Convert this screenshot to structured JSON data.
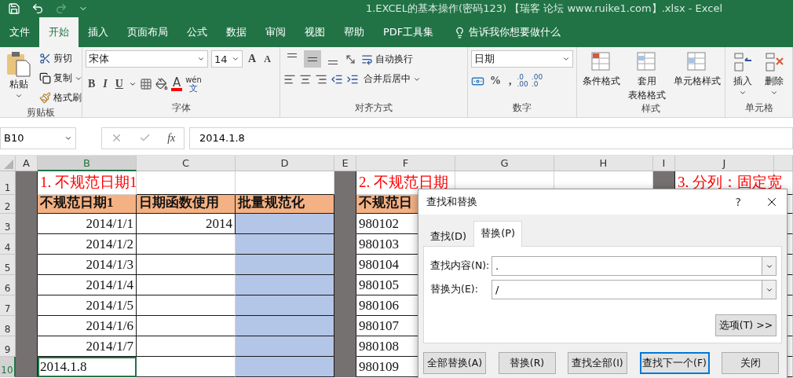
{
  "window": {
    "title": "1.EXCEL的基本操作(密码123) 【瑞客 论坛 www.ruike1.com】.xlsx  -  Excel"
  },
  "ribbon_tabs": [
    {
      "label": "文件",
      "selected": false
    },
    {
      "label": "开始",
      "selected": true
    },
    {
      "label": "插入",
      "selected": false
    },
    {
      "label": "页面布局",
      "selected": false
    },
    {
      "label": "公式",
      "selected": false
    },
    {
      "label": "数据",
      "selected": false
    },
    {
      "label": "审阅",
      "selected": false
    },
    {
      "label": "视图",
      "selected": false
    },
    {
      "label": "帮助",
      "selected": false
    },
    {
      "label": "PDF工具集",
      "selected": false
    }
  ],
  "tell_me": "告诉我你想要做什么",
  "clipboard": {
    "paste": "粘贴",
    "cut": "剪切",
    "copy": "复制",
    "format_painter": "格式刷",
    "label": "剪贴板"
  },
  "font": {
    "name": "宋体",
    "size": "14",
    "grow": "A",
    "shrink": "A",
    "bold": "B",
    "italic": "I",
    "underline": "U",
    "font_color": "A",
    "phonetic_top": "wén",
    "phonetic_bottom": "文",
    "label": "字体"
  },
  "alignment": {
    "vertical": [
      {
        "selected": false
      },
      {
        "selected": true
      },
      {
        "selected": false
      }
    ],
    "wrap_text": "自动换行",
    "merge_center": "合并后居中",
    "label": "对齐方式"
  },
  "number": {
    "format": "日期",
    "percent": "%",
    "comma": ",",
    "increase_decimal": [
      ".0",
      ".00"
    ],
    "decrease_decimal": [
      ".00",
      ".0"
    ],
    "label": "数字"
  },
  "styles": {
    "items": [
      [
        "条件格式"
      ],
      [
        "套用",
        "表格格式"
      ],
      [
        "单元格样式"
      ]
    ],
    "label": "样式"
  },
  "cells": {
    "items": [
      "插入",
      "删除"
    ],
    "label": "单元格"
  },
  "formula_bar": {
    "name_box": "B10",
    "function_label": "fx",
    "value": "2014.1.8"
  },
  "sheet": {
    "columns": [
      {
        "label": "A",
        "kind": "narrow",
        "selected": false
      },
      {
        "label": "B",
        "kind": "wide",
        "selected": true
      },
      {
        "label": "C",
        "kind": "wide",
        "selected": false
      },
      {
        "label": "D",
        "kind": "wide",
        "selected": false
      },
      {
        "label": "E",
        "kind": "narrow",
        "selected": false
      },
      {
        "label": "F",
        "kind": "wide",
        "selected": false
      },
      {
        "label": "G",
        "kind": "wide",
        "selected": false
      },
      {
        "label": "H",
        "kind": "wide",
        "selected": false
      },
      {
        "label": "I",
        "kind": "narrow",
        "selected": false
      },
      {
        "label": "J",
        "kind": "wide",
        "selected": false
      }
    ],
    "rows": [
      {
        "label": "1",
        "selected": false,
        "cells": [
          {
            "kind": "spacer"
          },
          {
            "kind": "title",
            "text": "1. 不规范日期1"
          },
          {
            "kind": "plain"
          },
          {
            "kind": "plain"
          },
          {
            "kind": "spacer"
          },
          {
            "kind": "title",
            "text": "2. 不规范日期"
          },
          {
            "kind": "plain"
          },
          {
            "kind": "plain"
          },
          {
            "kind": "spacer"
          },
          {
            "kind": "title",
            "text": "3. 分列：固定宽"
          }
        ]
      },
      {
        "label": "2",
        "selected": false,
        "cells": [
          {
            "kind": "spacer"
          },
          {
            "kind": "header",
            "text": "不规范日期1"
          },
          {
            "kind": "header",
            "text": "日期函数使用"
          },
          {
            "kind": "header",
            "text": "批量规范化"
          },
          {
            "kind": "spacer"
          },
          {
            "kind": "header",
            "text": "不规范日"
          }
        ]
      },
      {
        "label": "3",
        "selected": false,
        "cells": [
          {
            "kind": "spacer"
          },
          {
            "kind": "number",
            "text": "2014/1/1"
          },
          {
            "kind": "number",
            "text": "2014"
          },
          {
            "kind": "fill"
          },
          {
            "kind": "spacer"
          },
          {
            "kind": "plain",
            "text": "980102"
          }
        ]
      },
      {
        "label": "4",
        "selected": false,
        "cells": [
          {
            "kind": "spacer"
          },
          {
            "kind": "number",
            "text": "2014/1/2"
          },
          {
            "kind": "plain"
          },
          {
            "kind": "fill"
          },
          {
            "kind": "spacer"
          },
          {
            "kind": "plain",
            "text": "980103"
          }
        ]
      },
      {
        "label": "5",
        "selected": false,
        "cells": [
          {
            "kind": "spacer"
          },
          {
            "kind": "number",
            "text": "2014/1/3"
          },
          {
            "kind": "plain"
          },
          {
            "kind": "fill"
          },
          {
            "kind": "spacer"
          },
          {
            "kind": "plain",
            "text": "980104"
          }
        ]
      },
      {
        "label": "6",
        "selected": false,
        "cells": [
          {
            "kind": "spacer"
          },
          {
            "kind": "number",
            "text": "2014/1/4"
          },
          {
            "kind": "plain"
          },
          {
            "kind": "fill"
          },
          {
            "kind": "spacer"
          },
          {
            "kind": "plain",
            "text": "980105"
          }
        ]
      },
      {
        "label": "7",
        "selected": false,
        "cells": [
          {
            "kind": "spacer"
          },
          {
            "kind": "number",
            "text": "2014/1/5"
          },
          {
            "kind": "plain"
          },
          {
            "kind": "fill"
          },
          {
            "kind": "spacer"
          },
          {
            "kind": "plain",
            "text": "980106"
          }
        ]
      },
      {
        "label": "8",
        "selected": false,
        "cells": [
          {
            "kind": "spacer"
          },
          {
            "kind": "number",
            "text": "2014/1/6"
          },
          {
            "kind": "plain"
          },
          {
            "kind": "fill"
          },
          {
            "kind": "spacer"
          },
          {
            "kind": "plain",
            "text": "980107"
          }
        ]
      },
      {
        "label": "9",
        "selected": false,
        "cells": [
          {
            "kind": "spacer"
          },
          {
            "kind": "number",
            "text": "2014/1/7"
          },
          {
            "kind": "plain"
          },
          {
            "kind": "fill"
          },
          {
            "kind": "spacer"
          },
          {
            "kind": "plain",
            "text": "980108"
          }
        ]
      },
      {
        "label": "10",
        "selected": true,
        "cells": [
          {
            "kind": "spacer"
          },
          {
            "kind": "plain",
            "text": "2014.1.8"
          },
          {
            "kind": "plain"
          },
          {
            "kind": "fill"
          },
          {
            "kind": "spacer"
          },
          {
            "kind": "plain",
            "text": "980109"
          }
        ]
      }
    ]
  },
  "dialog": {
    "title": "查找和替换",
    "help": "?",
    "tabs": [
      {
        "label": "查找(D)",
        "selected": false
      },
      {
        "label": "替换(P)",
        "selected": true
      }
    ],
    "fields": [
      {
        "label": "查找内容(N):",
        "value": "."
      },
      {
        "label": "替换为(E):",
        "value": "/"
      }
    ],
    "options": "选项(T) >>",
    "buttons": [
      {
        "label": "全部替换(A)",
        "default": false
      },
      {
        "label": "替换(R)",
        "default": false
      },
      {
        "label": "查找全部(I)",
        "default": false
      },
      {
        "label": "查找下一个(F)",
        "default": true
      },
      {
        "label": "关闭",
        "default": false
      }
    ]
  }
}
